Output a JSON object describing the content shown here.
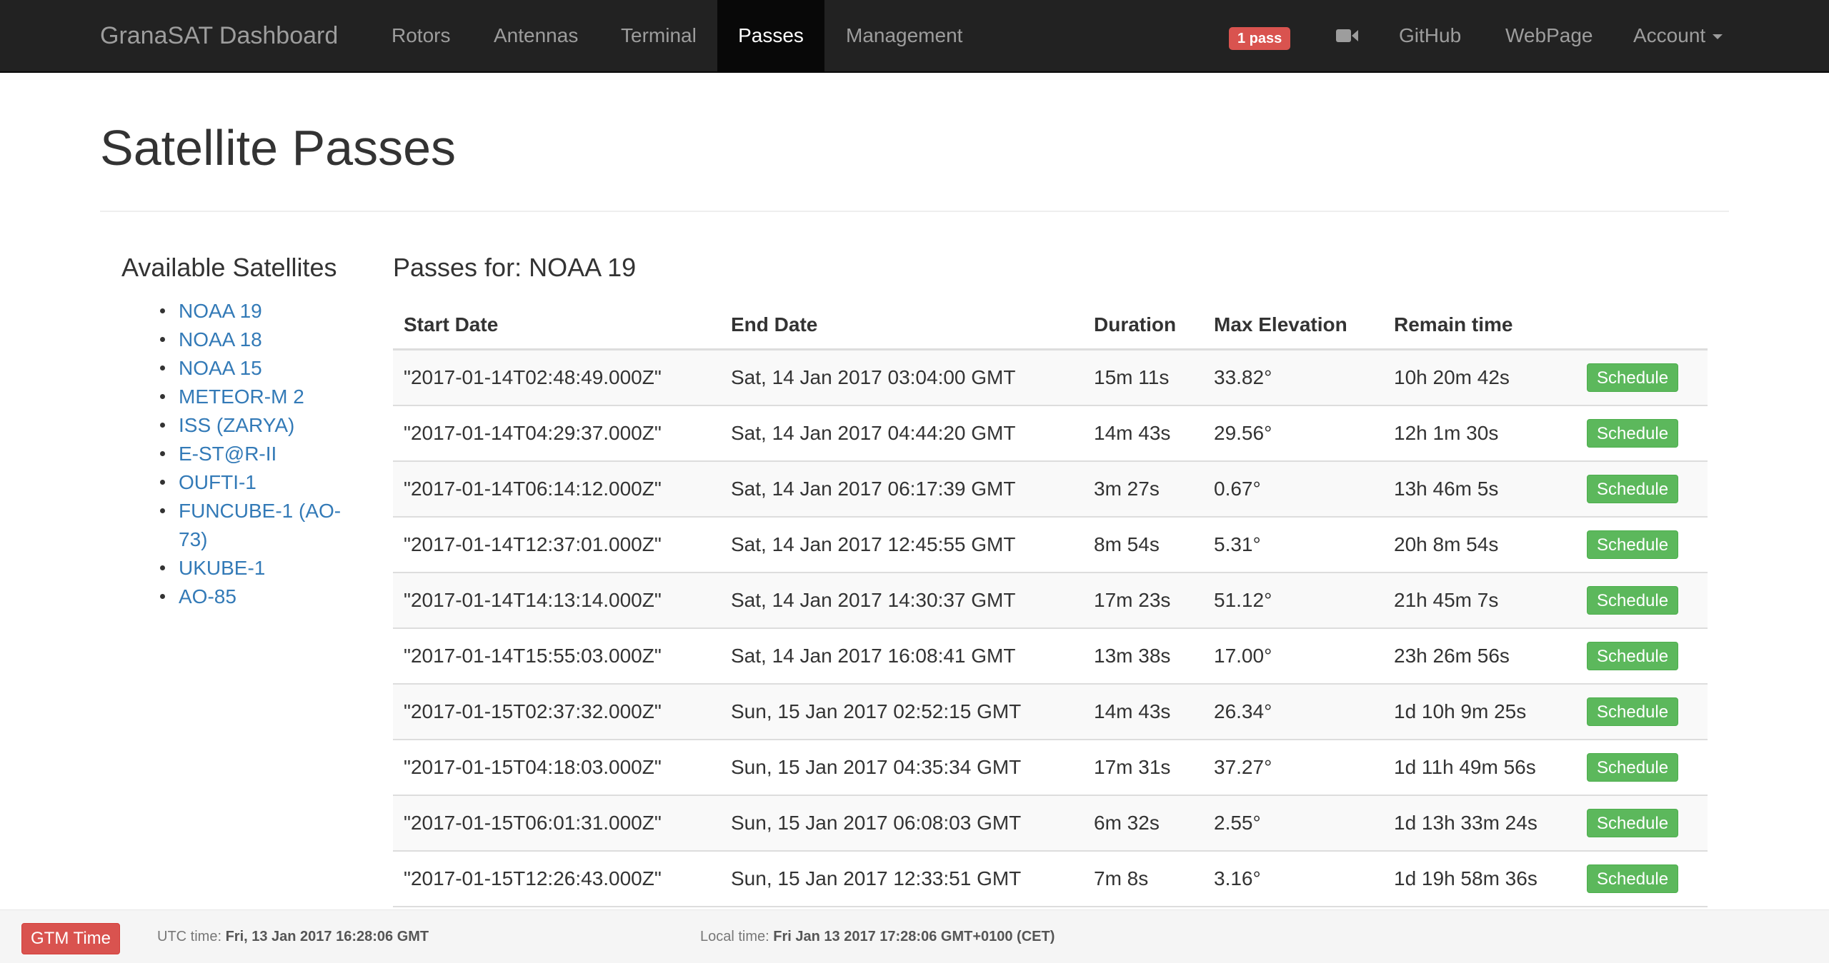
{
  "navbar": {
    "brand": "GranaSAT Dashboard",
    "links": [
      "Rotors",
      "Antennas",
      "Terminal",
      "Passes",
      "Management"
    ],
    "active": "Passes",
    "badge": "1 pass",
    "camera_icon": "video-camera-icon",
    "right_links": [
      "GitHub",
      "WebPage",
      "Account"
    ]
  },
  "page": {
    "title": "Satellite Passes"
  },
  "sidebar": {
    "title": "Available Satellites",
    "satellites": [
      "NOAA 19",
      "NOAA 18",
      "NOAA 15",
      "METEOR-M 2",
      "ISS (ZARYA)",
      "E-ST@R-II",
      "OUFTI-1",
      "FUNCUBE-1 (AO-73)",
      "UKUBE-1",
      "AO-85"
    ]
  },
  "passes": {
    "title": "Passes for: NOAA 19",
    "headers": [
      "Start Date",
      "End Date",
      "Duration",
      "Max Elevation",
      "Remain time",
      ""
    ],
    "button_label": "Schedule",
    "rows": [
      [
        "\"2017-01-14T02:48:49.000Z\"",
        "Sat, 14 Jan 2017 03:04:00 GMT",
        "15m 11s",
        "33.82°",
        "10h 20m 42s"
      ],
      [
        "\"2017-01-14T04:29:37.000Z\"",
        "Sat, 14 Jan 2017 04:44:20 GMT",
        "14m 43s",
        "29.56°",
        "12h 1m 30s"
      ],
      [
        "\"2017-01-14T06:14:12.000Z\"",
        "Sat, 14 Jan 2017 06:17:39 GMT",
        "3m 27s",
        "0.67°",
        "13h 46m 5s"
      ],
      [
        "\"2017-01-14T12:37:01.000Z\"",
        "Sat, 14 Jan 2017 12:45:55 GMT",
        "8m 54s",
        "5.31°",
        "20h 8m 54s"
      ],
      [
        "\"2017-01-14T14:13:14.000Z\"",
        "Sat, 14 Jan 2017 14:30:37 GMT",
        "17m 23s",
        "51.12°",
        "21h 45m 7s"
      ],
      [
        "\"2017-01-14T15:55:03.000Z\"",
        "Sat, 14 Jan 2017 16:08:41 GMT",
        "13m 38s",
        "17.00°",
        "23h 26m 56s"
      ],
      [
        "\"2017-01-15T02:37:32.000Z\"",
        "Sun, 15 Jan 2017 02:52:15 GMT",
        "14m 43s",
        "26.34°",
        "1d 10h 9m 25s"
      ],
      [
        "\"2017-01-15T04:18:03.000Z\"",
        "Sun, 15 Jan 2017 04:35:34 GMT",
        "17m 31s",
        "37.27°",
        "1d 11h 49m 56s"
      ],
      [
        "\"2017-01-15T06:01:31.000Z\"",
        "Sun, 15 Jan 2017 06:08:03 GMT",
        "6m 32s",
        "2.55°",
        "1d 13h 33m 24s"
      ],
      [
        "\"2017-01-15T12:26:43.000Z\"",
        "Sun, 15 Jan 2017 12:33:51 GMT",
        "7m 8s",
        "3.16°",
        "1d 19h 58m 36s"
      ]
    ]
  },
  "footer": {
    "gtm_button": "GTM Time",
    "utc_label": "UTC time:",
    "utc_value": "Fri, 13 Jan 2017 16:28:06 GMT",
    "local_label": "Local time:",
    "local_value": "Fri Jan 13 2017 17:28:06 GMT+0100 (CET)"
  },
  "colors": {
    "navbar_bg": "#222222",
    "link": "#337ab7",
    "success": "#5cb85c",
    "danger": "#d9534f"
  }
}
